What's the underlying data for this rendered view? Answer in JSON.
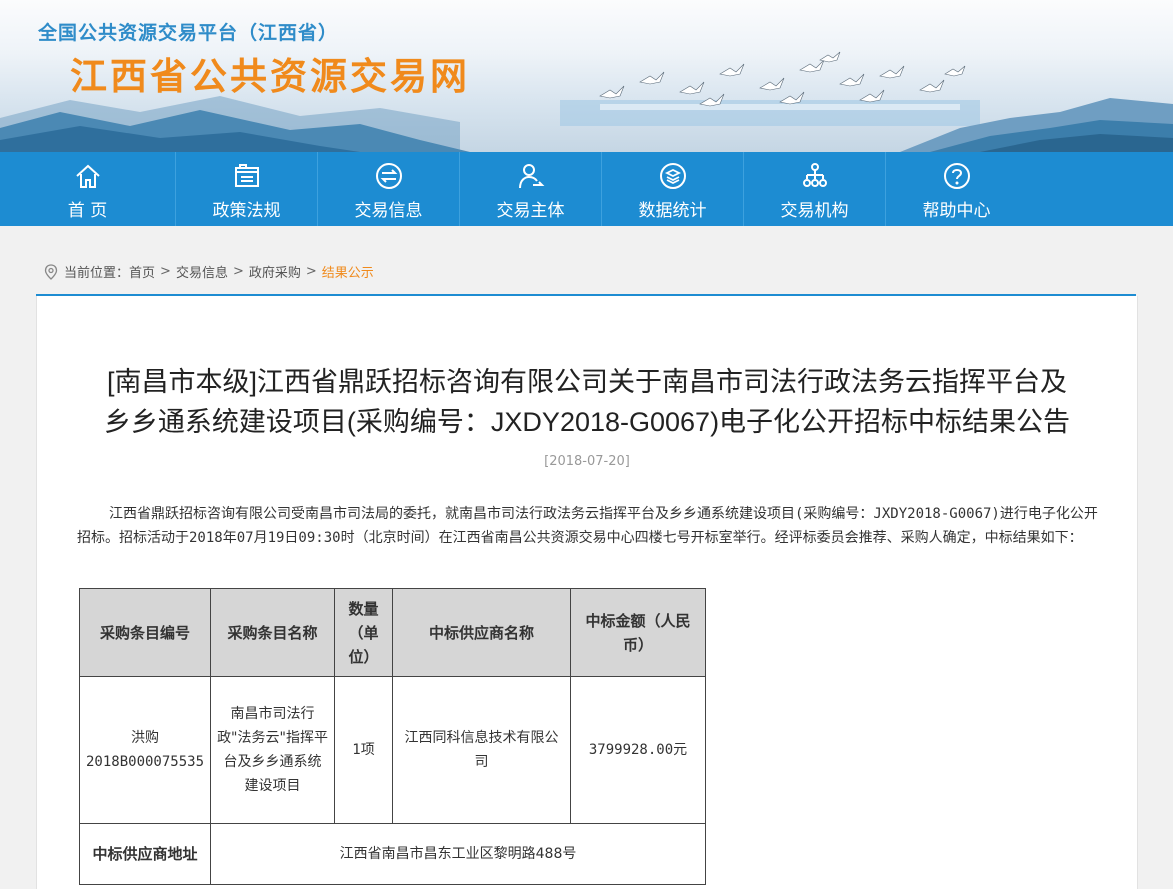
{
  "header": {
    "platform_name": "全国公共资源交易平台（江西省）",
    "site_title": "江西省公共资源交易网"
  },
  "nav": {
    "items": [
      {
        "label": "首 页",
        "icon": "home-icon"
      },
      {
        "label": "政策法规",
        "icon": "document-icon"
      },
      {
        "label": "交易信息",
        "icon": "exchange-icon"
      },
      {
        "label": "交易主体",
        "icon": "user-icon"
      },
      {
        "label": "数据统计",
        "icon": "layers-icon"
      },
      {
        "label": "交易机构",
        "icon": "org-chart-icon"
      },
      {
        "label": "帮助中心",
        "icon": "help-icon"
      }
    ]
  },
  "breadcrumb": {
    "prefix": "当前位置：",
    "items": [
      "首页",
      "交易信息",
      "政府采购"
    ],
    "current": "结果公示"
  },
  "article": {
    "title_line1": "[南昌市本级]江西省鼎跃招标咨询有限公司关于南昌市司法行政法务云指挥平台及",
    "title_line2": "乡乡通系统建设项目(采购编号：JXDY2018-G0067)电子化公开招标中标结果公告",
    "date": "[2018-07-20]",
    "intro": "江西省鼎跃招标咨询有限公司受南昌市司法局的委托，就南昌市司法行政法务云指挥平台及乡乡通系统建设项目(采购编号：JXDY2018-G0067)进行电子化公开招标。招标活动于2018年07月19日09:30时（北京时间）在江西省南昌公共资源交易中心四楼七号开标室举行。经评标委员会推荐、采购人确定，中标结果如下："
  },
  "table": {
    "headers": {
      "item_no": "采购条目编号",
      "item_name": "采购条目名称",
      "quantity": "数量（单位）",
      "supplier": "中标供应商名称",
      "amount": "中标金额（人民币）"
    },
    "row": {
      "item_no_1": "洪购",
      "item_no_2": "2018B000075535",
      "item_name": "南昌市司法行政\"法务云\"指挥平台及乡乡通系统建设项目",
      "quantity": "1项",
      "supplier": "江西同科信息技术有限公司",
      "amount": "3799928.00元"
    },
    "address_label": "中标供应商地址",
    "address_value": "江西省南昌市昌东工业区黎明路488号"
  },
  "colors": {
    "nav_blue": "#1d8cd2",
    "title_orange": "#f08a1c",
    "platform_blue": "#2f8cc9"
  }
}
